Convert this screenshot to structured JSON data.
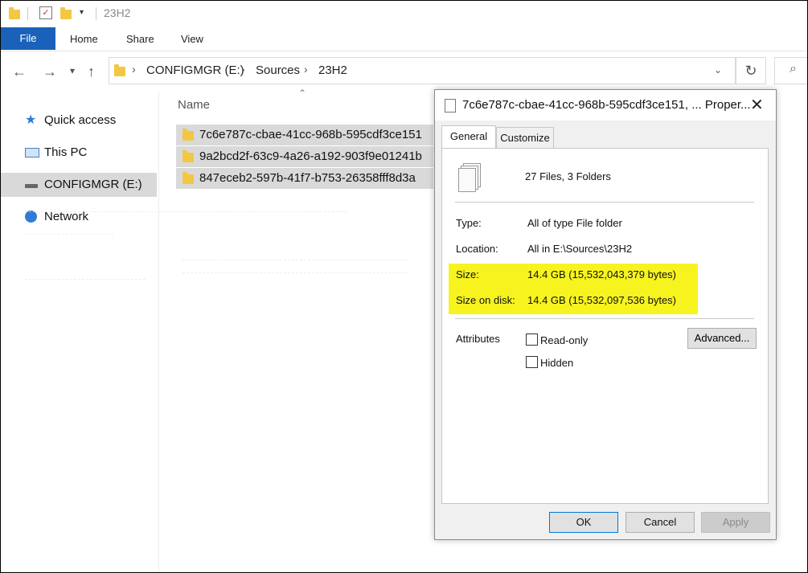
{
  "window": {
    "title": "23H2"
  },
  "ribbon": {
    "tabs": [
      "File",
      "Home",
      "Share",
      "View"
    ]
  },
  "address": {
    "crumbs": [
      "CONFIGMGR (E:)",
      "Sources",
      "23H2"
    ]
  },
  "nav_pane": {
    "items": [
      "Quick access",
      "This PC",
      "CONFIGMGR (E:)",
      "Network"
    ]
  },
  "list": {
    "column": "Name",
    "rows": [
      "7c6e787c-cbae-41cc-968b-595cdf3ce151",
      "9a2bcd2f-63c9-4a26-a192-903f9e01241b",
      "847eceb2-597b-41f7-b753-26358fff8d3a"
    ]
  },
  "dialog": {
    "title": "7c6e787c-cbae-41cc-968b-595cdf3ce151, ... Proper...",
    "tabs": [
      "General",
      "Customize"
    ],
    "summary": "27 Files, 3 Folders",
    "type_label": "Type:",
    "type_value": "All of type File folder",
    "location_label": "Location:",
    "location_value": "All in E:\\Sources\\23H2",
    "size_label": "Size:",
    "size_value": "14.4 GB (15,532,043,379 bytes)",
    "size_disk_label": "Size on disk:",
    "size_disk_value": "14.4 GB (15,532,097,536 bytes)",
    "attributes_label": "Attributes",
    "readonly_label": "Read-only",
    "hidden_label": "Hidden",
    "advanced_label": "Advanced...",
    "ok_label": "OK",
    "cancel_label": "Cancel",
    "apply_label": "Apply"
  },
  "colors": {
    "accent": "#1a62b9",
    "highlight": "#f7f31f",
    "selection": "#d9d9d9"
  }
}
